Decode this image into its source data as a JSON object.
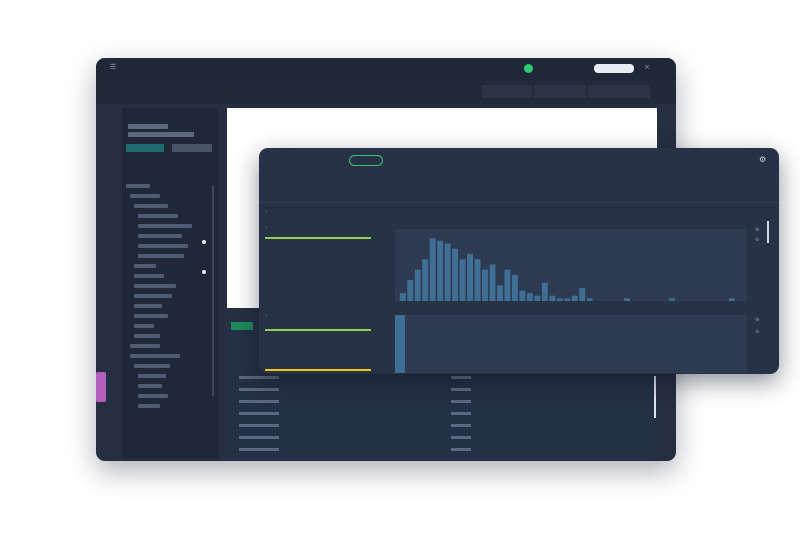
{
  "colors": {
    "accent_green": "#3ec37a",
    "bar_green": "#8fd14f",
    "bar_yellow": "#f1c40f",
    "hist_bar": "#3f6f94",
    "status_dot": "#2ecc71",
    "window_bg": "#262f41"
  },
  "icons": {
    "menu": "☰",
    "chevron": "›",
    "close": "×",
    "gear": "⚙",
    "settings": "⚙"
  },
  "chart_data": {
    "type": "bar",
    "values": [
      3,
      8,
      12,
      16,
      24,
      23,
      22,
      20,
      16,
      18,
      16,
      12,
      14,
      6,
      12,
      10,
      4,
      3,
      2,
      7,
      2,
      1,
      1,
      2,
      5,
      1,
      0,
      0,
      0,
      0,
      1,
      0,
      0,
      0,
      0,
      0,
      1,
      0,
      0,
      0,
      0,
      0,
      0,
      0,
      1,
      0
    ],
    "ylim": [
      0,
      26
    ],
    "grid": false,
    "legend": "none"
  }
}
